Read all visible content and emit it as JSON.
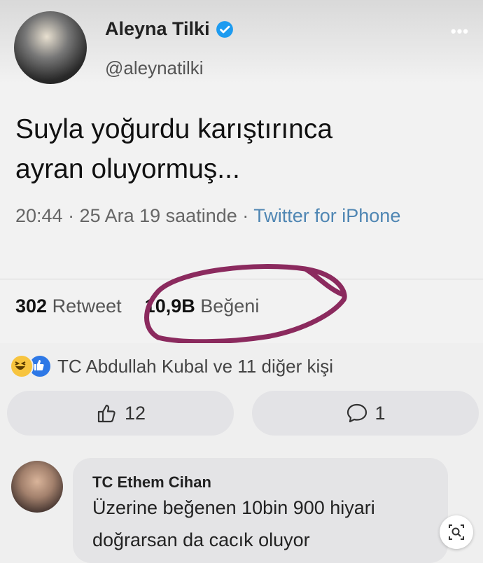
{
  "tweet": {
    "author_name": "Aleyna Tilki",
    "handle": "@aleynatilki",
    "text_line1": "Suyla yoğurdu karıştırınca",
    "text_line2": "ayran oluyormuş...",
    "meta_time": "20:44 · 25 Ara 19 saatinde · ",
    "meta_source": "Twitter for iPhone",
    "retweet_count": "302",
    "retweet_label": "Retweet",
    "like_count": "10,9B",
    "like_label": "Beğeni",
    "more_icon": "ellipsis-icon",
    "verified_color": "#1d9bf0"
  },
  "facebook": {
    "reactions_text": "TC Abdullah Kubal ve 11 diğer kişi",
    "like_count": "12",
    "comment_count": "1",
    "comment": {
      "author": "TC Ethem Cihan",
      "line1": "Üzerine beğenen 10bin 900 hiyari",
      "line2": "doğrarsan da cacık oluyor"
    }
  },
  "colors": {
    "annotation_circle": "#8b2a5e",
    "link": "#4f86b3"
  }
}
